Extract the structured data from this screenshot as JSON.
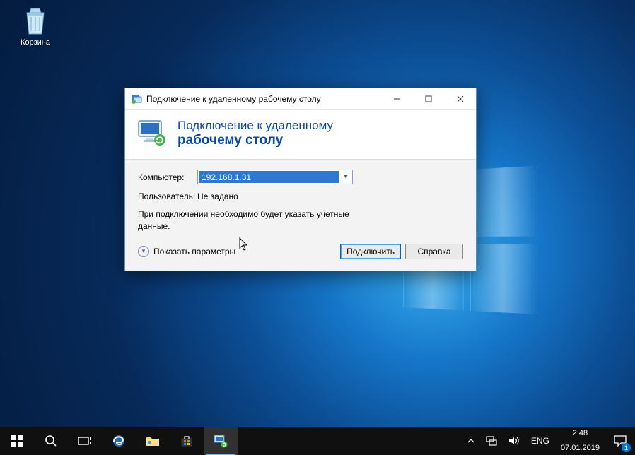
{
  "desktop": {
    "recycle_bin_label": "Корзина"
  },
  "dialog": {
    "window_title": "Подключение к удаленному рабочему столу",
    "header_line1": "Подключение к удаленному",
    "header_line2": "рабочему столу",
    "computer_label": "Компьютер:",
    "computer_value": "192.168.1.31",
    "user_label": "Пользователь:",
    "user_value": "Не задано",
    "hint": "При подключении необходимо будет указать учетные данные.",
    "show_options": "Показать параметры",
    "connect": "Подключить",
    "help": "Справка"
  },
  "taskbar": {
    "lang": "ENG",
    "time": "2:48",
    "date": "07.01.2019",
    "notif_count": "1"
  }
}
